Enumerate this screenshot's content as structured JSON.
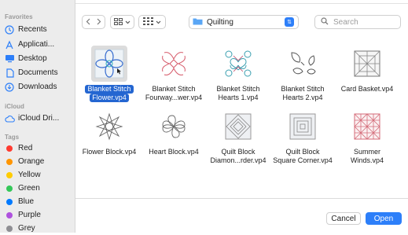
{
  "sidebar": {
    "favorites_header": "Favorites",
    "favorites": [
      {
        "label": "Recents",
        "icon": "clock-icon"
      },
      {
        "label": "Applicati...",
        "icon": "apps-icon"
      },
      {
        "label": "Desktop",
        "icon": "desktop-icon"
      },
      {
        "label": "Documents",
        "icon": "document-icon"
      },
      {
        "label": "Downloads",
        "icon": "download-icon"
      }
    ],
    "icloud_header": "iCloud",
    "icloud": [
      {
        "label": "iCloud Dri...",
        "icon": "cloud-icon"
      }
    ],
    "tags_header": "Tags",
    "tags": [
      {
        "label": "Red",
        "color": "#ff3b30"
      },
      {
        "label": "Orange",
        "color": "#ff9500"
      },
      {
        "label": "Yellow",
        "color": "#ffcc00"
      },
      {
        "label": "Green",
        "color": "#34c759"
      },
      {
        "label": "Blue",
        "color": "#007aff"
      },
      {
        "label": "Purple",
        "color": "#af52de"
      },
      {
        "label": "Grey",
        "color": "#8e8e93"
      }
    ]
  },
  "toolbar": {
    "location": "Quilting",
    "search_placeholder": "Search"
  },
  "files": [
    {
      "name_line1": "Blanket Stitch",
      "name_line2": "Flower.vp4",
      "selected": true
    },
    {
      "name_line1": "Blanket Stitch",
      "name_line2": "Fourway...wer.vp4",
      "selected": false
    },
    {
      "name_line1": "Blanket Stitch",
      "name_line2": "Hearts 1.vp4",
      "selected": false
    },
    {
      "name_line1": "Blanket Stitch",
      "name_line2": "Hearts 2.vp4",
      "selected": false
    },
    {
      "name_line1": "Card Basket.vp4",
      "name_line2": "",
      "selected": false
    },
    {
      "name_line1": "Flower Block.vp4",
      "name_line2": "",
      "selected": false
    },
    {
      "name_line1": "Heart Block.vp4",
      "name_line2": "",
      "selected": false
    },
    {
      "name_line1": "Quilt Block",
      "name_line2": "Diamon...rder.vp4",
      "selected": false
    },
    {
      "name_line1": "Quilt Block",
      "name_line2": "Square Corner.vp4",
      "selected": false
    },
    {
      "name_line1": "Summer",
      "name_line2": "Winds.vp4",
      "selected": false
    }
  ],
  "buttons": {
    "cancel": "Cancel",
    "open": "Open"
  },
  "colors": {
    "accent": "#2d7ff9",
    "selection": "#2466d1"
  }
}
